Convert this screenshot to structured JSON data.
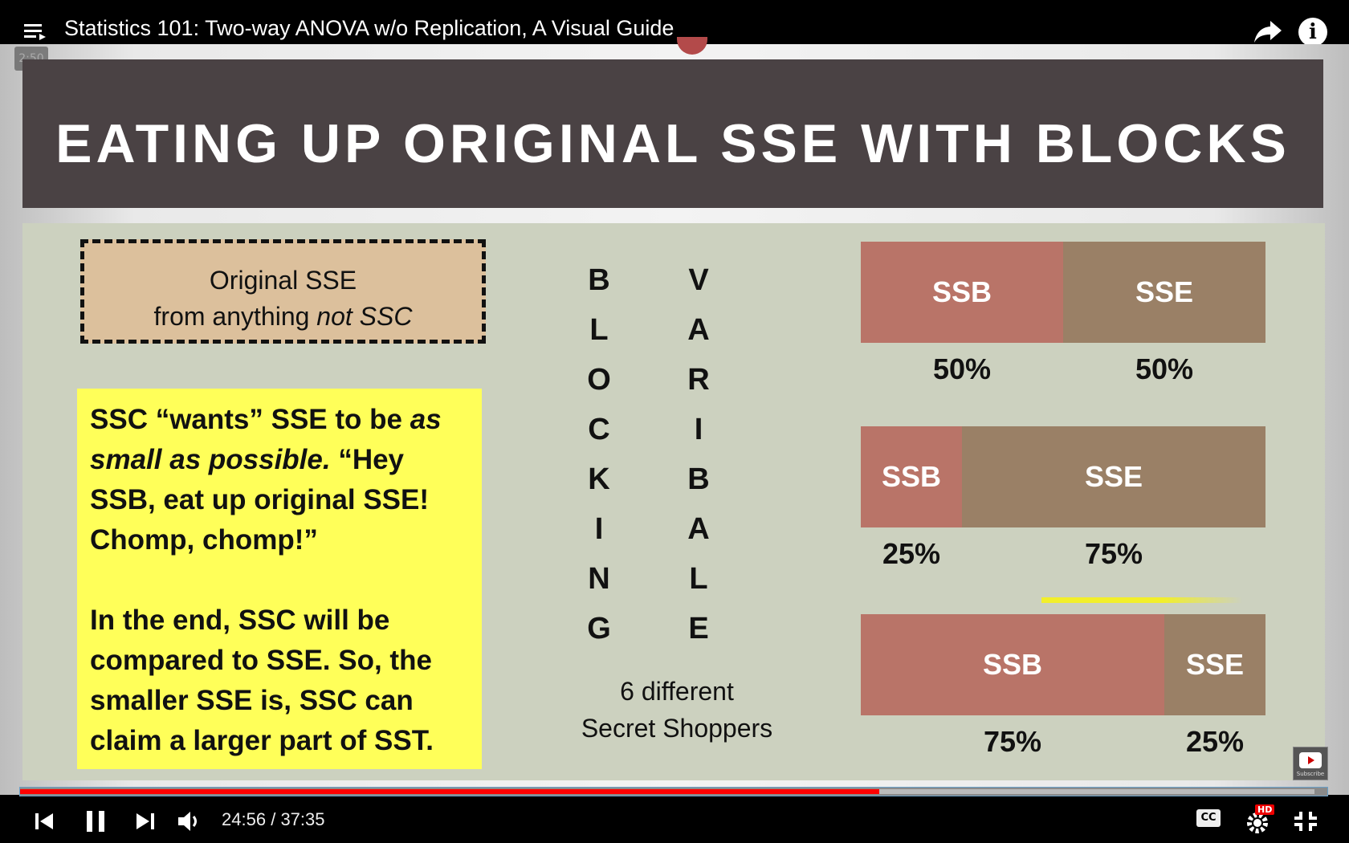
{
  "player": {
    "title": "Statistics 101: Two-way ANOVA w/o Replication, A Visual Guide",
    "preview_time": "2:50",
    "current_time": "24:56",
    "separator": "/",
    "duration": "37:35",
    "progress_fraction": 0.657,
    "buffer_fraction": 0.99,
    "hd_badge": "HD",
    "cc_label": "CC",
    "subscribe_label": "Subscribe",
    "colors": {
      "progress": "#ff0000",
      "bar_bg": "#000000"
    }
  },
  "slide": {
    "title": "EATING UP ORIGINAL SSE WITH BLOCKS",
    "original_box": {
      "line1": "Original SSE",
      "line2_pre": "from anything ",
      "line2_em": "not",
      "line2_post": " SSC"
    },
    "explanation": {
      "p1_a": "SSC “wants” SSE to be ",
      "p1_em": "as small as possible.",
      "p1_b": " “Hey SSB, eat up original SSE! Chomp, chomp!”",
      "p2": "In the end, SSC will be compared to SSE. So, the smaller SSE is, SSC can claim a larger part of SST."
    },
    "blocking_letters": [
      "B",
      "L",
      "O",
      "C",
      "K",
      "I",
      "N",
      "G"
    ],
    "variable_letters": [
      "V",
      "A",
      "R",
      "I",
      "B",
      "A",
      "L",
      "E"
    ],
    "shoppers_line1": "6 different",
    "shoppers_line2": "Secret Shoppers",
    "colors": {
      "header": "#4a4244",
      "body": "#ccd1bf",
      "ssb": "#b97468",
      "sse": "#9a8066",
      "note": "#ffff59",
      "orig": "#dcc09c"
    }
  },
  "bars": [
    {
      "ssb_label": "SSB",
      "sse_label": "SSE",
      "ssb_share": 0.5,
      "ssb_pct": "50%",
      "sse_pct": "50%"
    },
    {
      "ssb_label": "SSB",
      "sse_label": "SSE",
      "ssb_share": 0.25,
      "ssb_pct": "25%",
      "sse_pct": "75%"
    },
    {
      "ssb_label": "SSB",
      "sse_label": "SSE",
      "ssb_share": 0.75,
      "ssb_pct": "75%",
      "sse_pct": "25%"
    }
  ]
}
